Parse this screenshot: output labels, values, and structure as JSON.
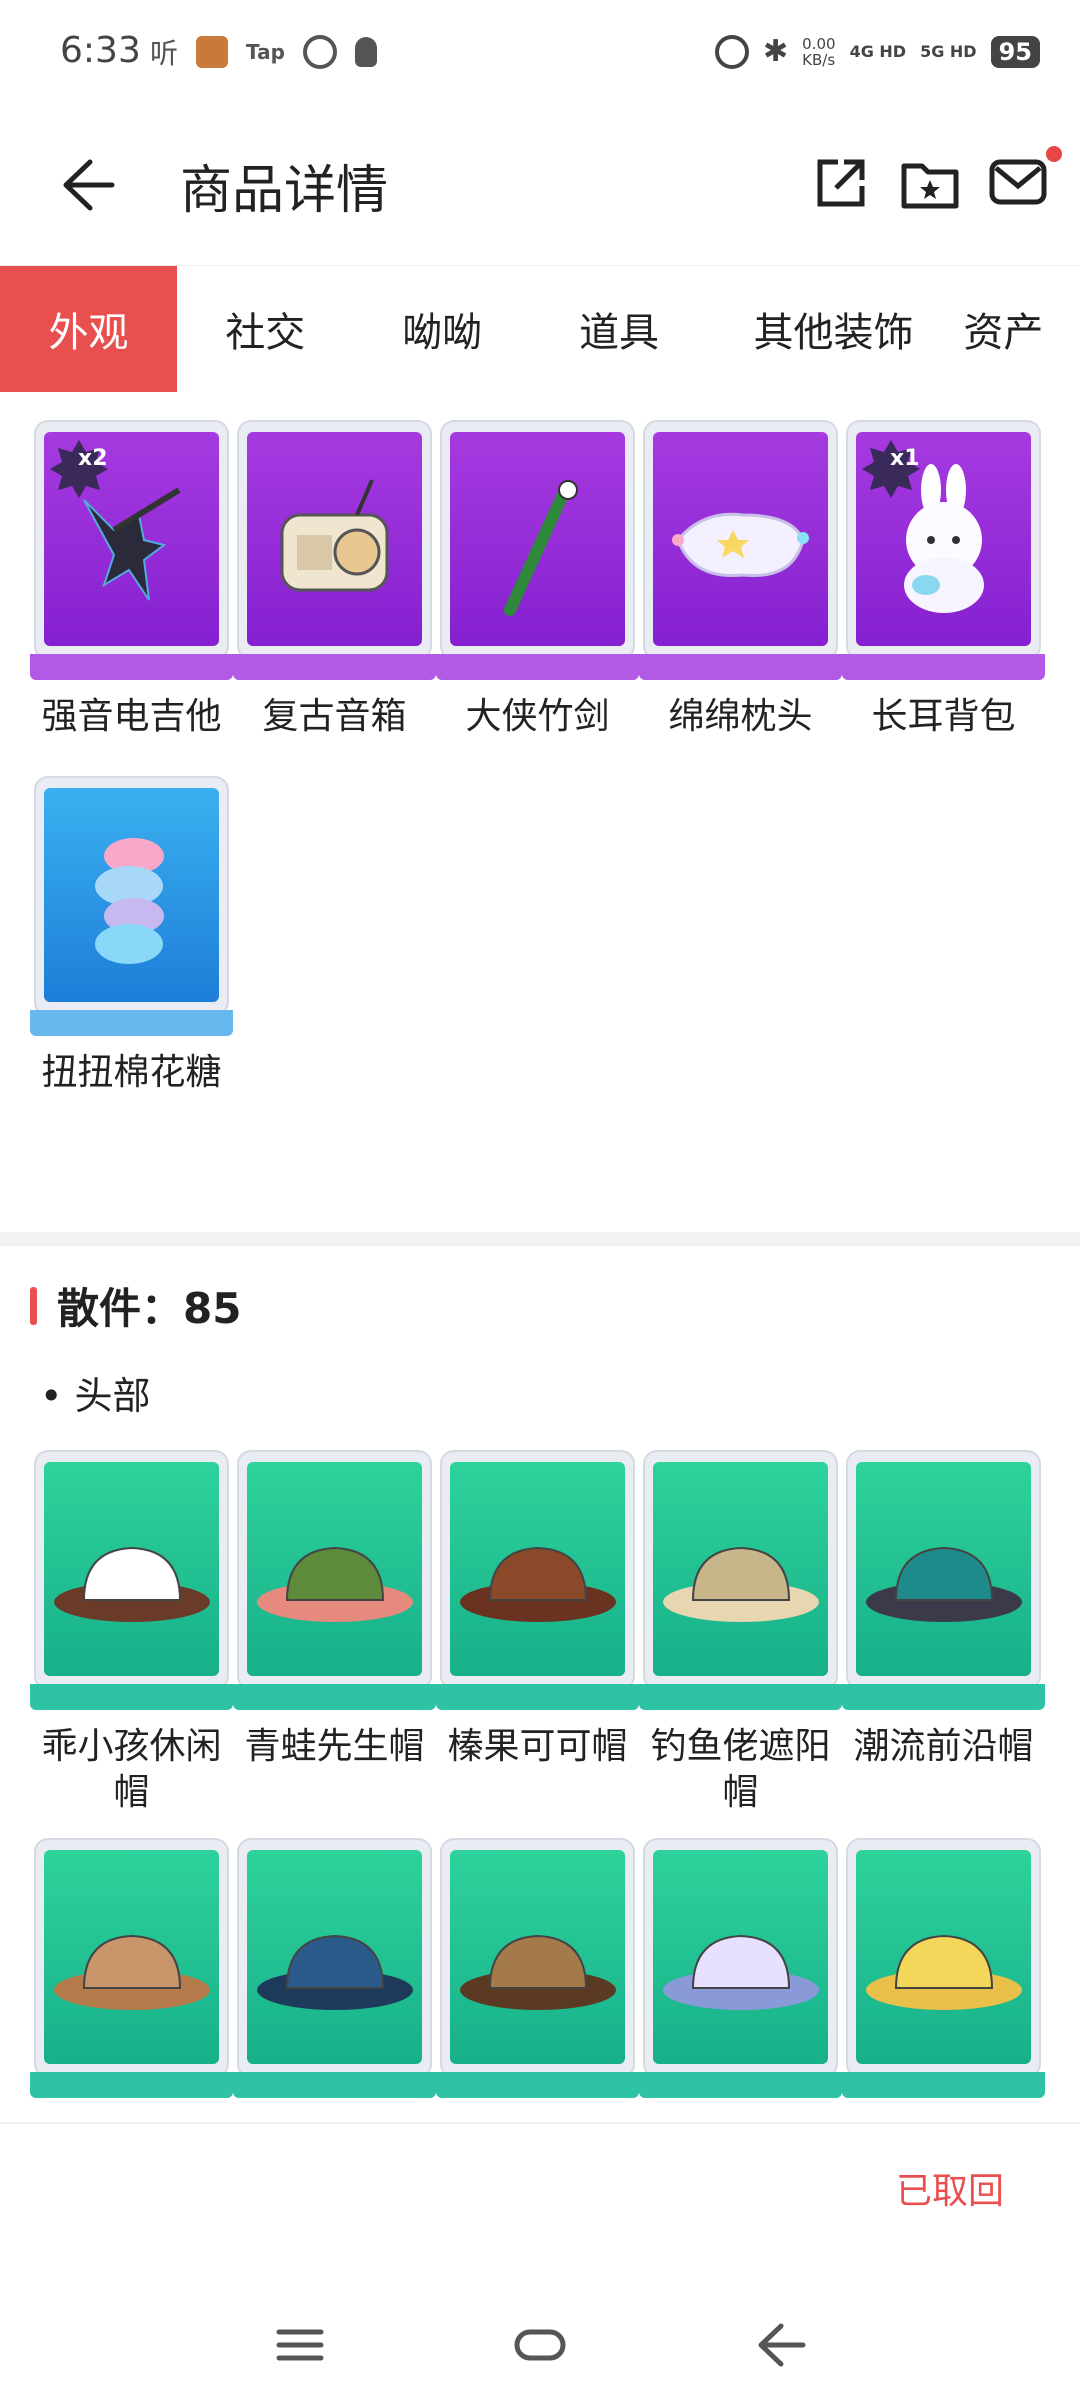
{
  "status": {
    "time": "6:33",
    "listen": "听",
    "tap": "Tap",
    "speed": "0.00\nKB/s",
    "net1": "4G HD",
    "net2": "5G HD",
    "battery": "95"
  },
  "header": {
    "title": "商品详情"
  },
  "tabs": [
    {
      "label": "外观",
      "active": true
    },
    {
      "label": "社交"
    },
    {
      "label": "呦呦"
    },
    {
      "label": "道具"
    },
    {
      "label": "其他装饰"
    },
    {
      "label": "资产"
    }
  ],
  "appearance": [
    {
      "name": "强音电吉他",
      "badge": "x2",
      "color": "purple",
      "icon": "guitar-icon"
    },
    {
      "name": "复古音箱",
      "color": "purple",
      "icon": "radio-icon"
    },
    {
      "name": "大侠竹剑",
      "color": "purple",
      "icon": "bamboo-sword-icon"
    },
    {
      "name": "绵绵枕头",
      "color": "purple",
      "icon": "pillow-icon"
    },
    {
      "name": "长耳背包",
      "badge": "x1",
      "color": "purple",
      "icon": "bunny-backpack-icon"
    },
    {
      "name": "扭扭棉花糖",
      "color": "blue",
      "icon": "marshmallow-icon"
    }
  ],
  "loose": {
    "title": "散件：85",
    "category": "• 头部"
  },
  "hats": [
    {
      "name": "乖小孩休闲帽",
      "hat": "#ffffff",
      "brim": "#6b3b2a"
    },
    {
      "name": "青蛙先生帽",
      "hat": "#5e8a3c",
      "brim": "#e58a7c"
    },
    {
      "name": "榛果可可帽",
      "hat": "#8a4a2a",
      "brim": "#6a3220"
    },
    {
      "name": "钓鱼佬遮阳帽",
      "hat": "#c8b58a",
      "brim": "#e8d6b0"
    },
    {
      "name": "潮流前沿帽",
      "hat": "#1e8a8a",
      "brim": "#3a3a4a"
    },
    {
      "name": "",
      "hat": "#c9956a",
      "brim": "#b47a4a"
    },
    {
      "name": "",
      "hat": "#2a5a8a",
      "brim": "#1e3a5a"
    },
    {
      "name": "",
      "hat": "#a57a4a",
      "brim": "#5a3a22"
    },
    {
      "name": "",
      "hat": "#e8e0ff",
      "brim": "#8a9ad8"
    },
    {
      "name": "",
      "hat": "#f2d75a",
      "brim": "#e8c04a"
    }
  ],
  "footer": {
    "status": "已取回"
  }
}
